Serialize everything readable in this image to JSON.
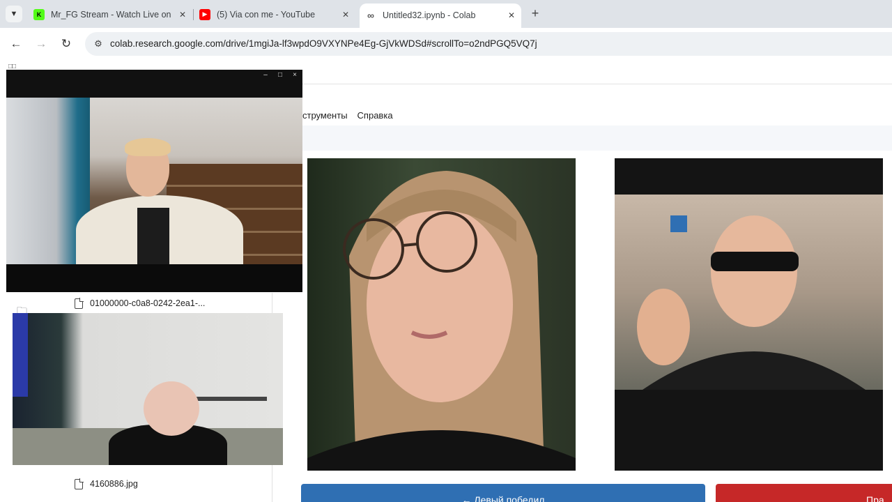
{
  "browser": {
    "tabs": [
      {
        "title": "Mr_FG Stream - Watch Live on K",
        "favicon_color": "#53fc18",
        "active": false
      },
      {
        "title": "(5) Via con me - YouTube",
        "favicon_color": "#ff0000",
        "active": false
      },
      {
        "title": "Untitled32.ipynb - Colab",
        "favicon_color": "#444444",
        "active": true
      }
    ],
    "url": "colab.research.google.com/drive/1mgiJa-lf3wpdO9VXYNPe4Eg-GjVkWDSd#scrollTo=o2ndPGQ5VQ7j"
  },
  "colab": {
    "menu": [
      "струменты",
      "Справка"
    ],
    "files": [
      {
        "name": "01000000-c0a8-0242-2ea1-..."
      },
      {
        "name": "4160886.jpg"
      }
    ],
    "buttons": {
      "left_label": "← Левый победил",
      "right_label": "Пра"
    }
  },
  "overlay": {
    "window_controls": [
      "–",
      "□",
      "×"
    ]
  }
}
